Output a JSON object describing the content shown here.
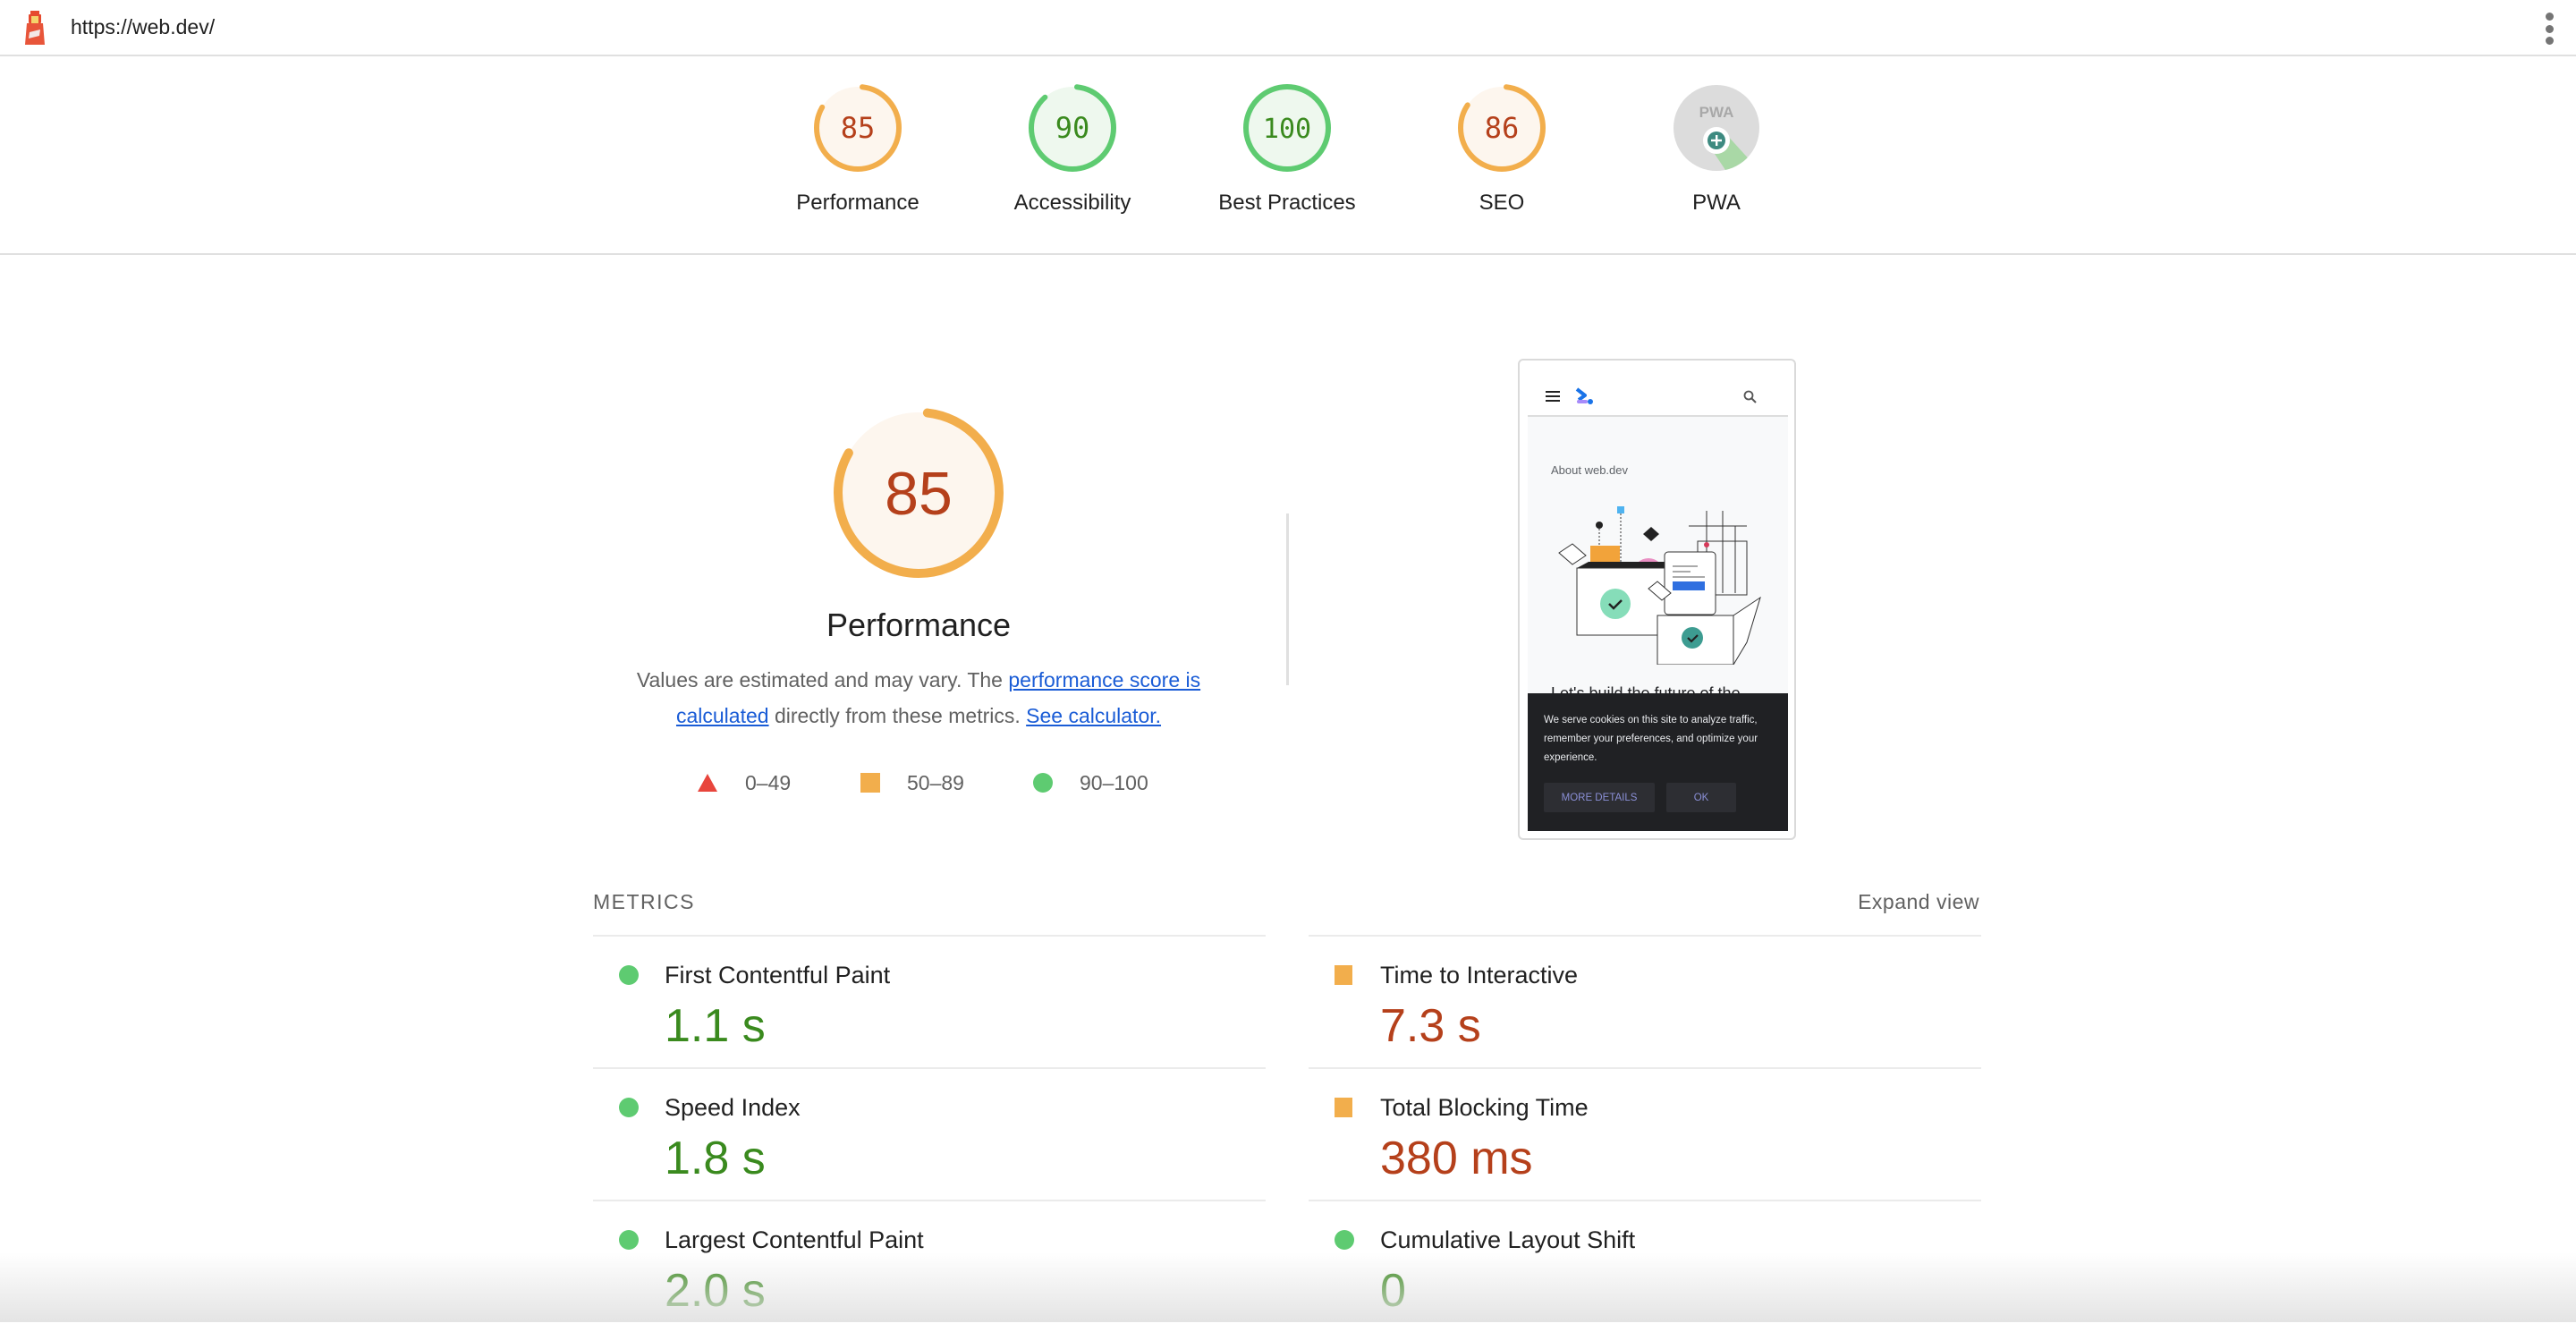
{
  "topbar": {
    "url": "https://web.dev/",
    "logo_icon": "lighthouse-icon",
    "menu_icon": "more-vert-icon"
  },
  "colors": {
    "pass": "#0cce6b",
    "pass_ring": "#5ecb71",
    "pass_text": "#3a8a1e",
    "pass_bg": "#eef8ee",
    "average_ring": "#f2ae4c",
    "average_text": "#b5401b",
    "average_bg": "#fdf6ee",
    "fail": "#e8453c",
    "link": "#1a5cd6"
  },
  "summary": {
    "categories": [
      {
        "label": "Performance",
        "score": 85,
        "rating": "average"
      },
      {
        "label": "Accessibility",
        "score": 90,
        "rating": "pass"
      },
      {
        "label": "Best Practices",
        "score": 100,
        "rating": "pass"
      },
      {
        "label": "SEO",
        "score": 86,
        "rating": "average"
      },
      {
        "label": "PWA",
        "score": null,
        "rating": "pwa",
        "badge_text": "PWA",
        "badge_icon": "pwa-plus-icon"
      }
    ]
  },
  "performance": {
    "score": 85,
    "title": "Performance",
    "desc_prefix": "Values are estimated and may vary. The ",
    "desc_link1": "performance score is calculated",
    "desc_middle": " directly from these metrics. ",
    "desc_link2": "See calculator.",
    "legend": [
      {
        "shape": "triangle",
        "range": "0–49"
      },
      {
        "shape": "square",
        "range": "50–89"
      },
      {
        "shape": "circle",
        "range": "90–100"
      }
    ]
  },
  "screenshot": {
    "about": "About web.dev",
    "headline": "Let's build the future of the",
    "cookie_text": "We serve cookies on this site to analyze traffic, remember your preferences, and optimize your experience.",
    "more_details": "MORE DETAILS",
    "ok": "OK"
  },
  "metrics": {
    "title": "METRICS",
    "expand": "Expand view",
    "left": [
      {
        "name": "First Contentful Paint",
        "value": "1.1 s",
        "rating": "pass"
      },
      {
        "name": "Speed Index",
        "value": "1.8 s",
        "rating": "pass"
      },
      {
        "name": "Largest Contentful Paint",
        "value": "2.0 s",
        "rating": "pass"
      }
    ],
    "right": [
      {
        "name": "Time to Interactive",
        "value": "7.3 s",
        "rating": "average"
      },
      {
        "name": "Total Blocking Time",
        "value": "380 ms",
        "rating": "average"
      },
      {
        "name": "Cumulative Layout Shift",
        "value": "0",
        "rating": "pass"
      }
    ]
  }
}
